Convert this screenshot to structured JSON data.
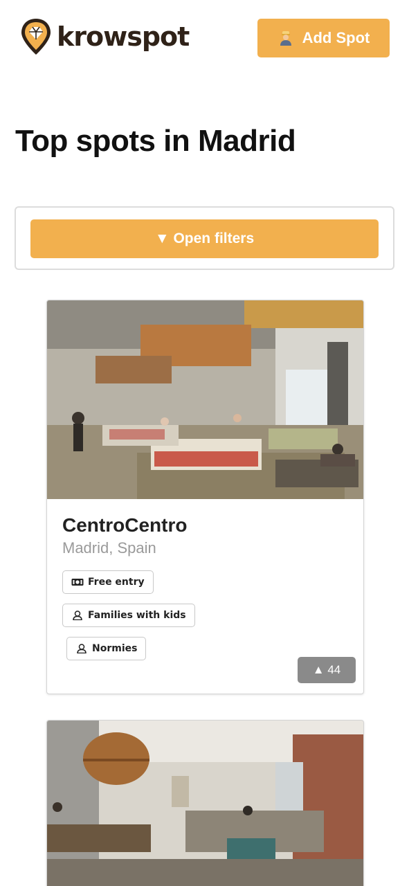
{
  "header": {
    "logo_text": "krowspot",
    "add_spot_label": "Add Spot",
    "add_spot_icon": "person-icon"
  },
  "page": {
    "title": "Top spots in Madrid"
  },
  "filters": {
    "toggle_label": "▼ Open filters"
  },
  "spots": [
    {
      "name": "CentroCentro",
      "location": "Madrid, Spain",
      "image": "lounge-interior-photo",
      "tags": [
        {
          "label": "Free entry",
          "icon": "money-icon"
        },
        {
          "label": "Families with kids",
          "icon": "user-icon"
        },
        {
          "label": "Normies",
          "icon": "user-icon"
        }
      ],
      "upvote_label": "▲ 44",
      "upvotes": 44
    },
    {
      "image": "cafe-interior-photo"
    }
  ],
  "colors": {
    "accent": "#f2b04e",
    "brand_dark": "#2f2218",
    "upvote_bg": "#8a8a8a",
    "muted_text": "#9a9a9a"
  }
}
